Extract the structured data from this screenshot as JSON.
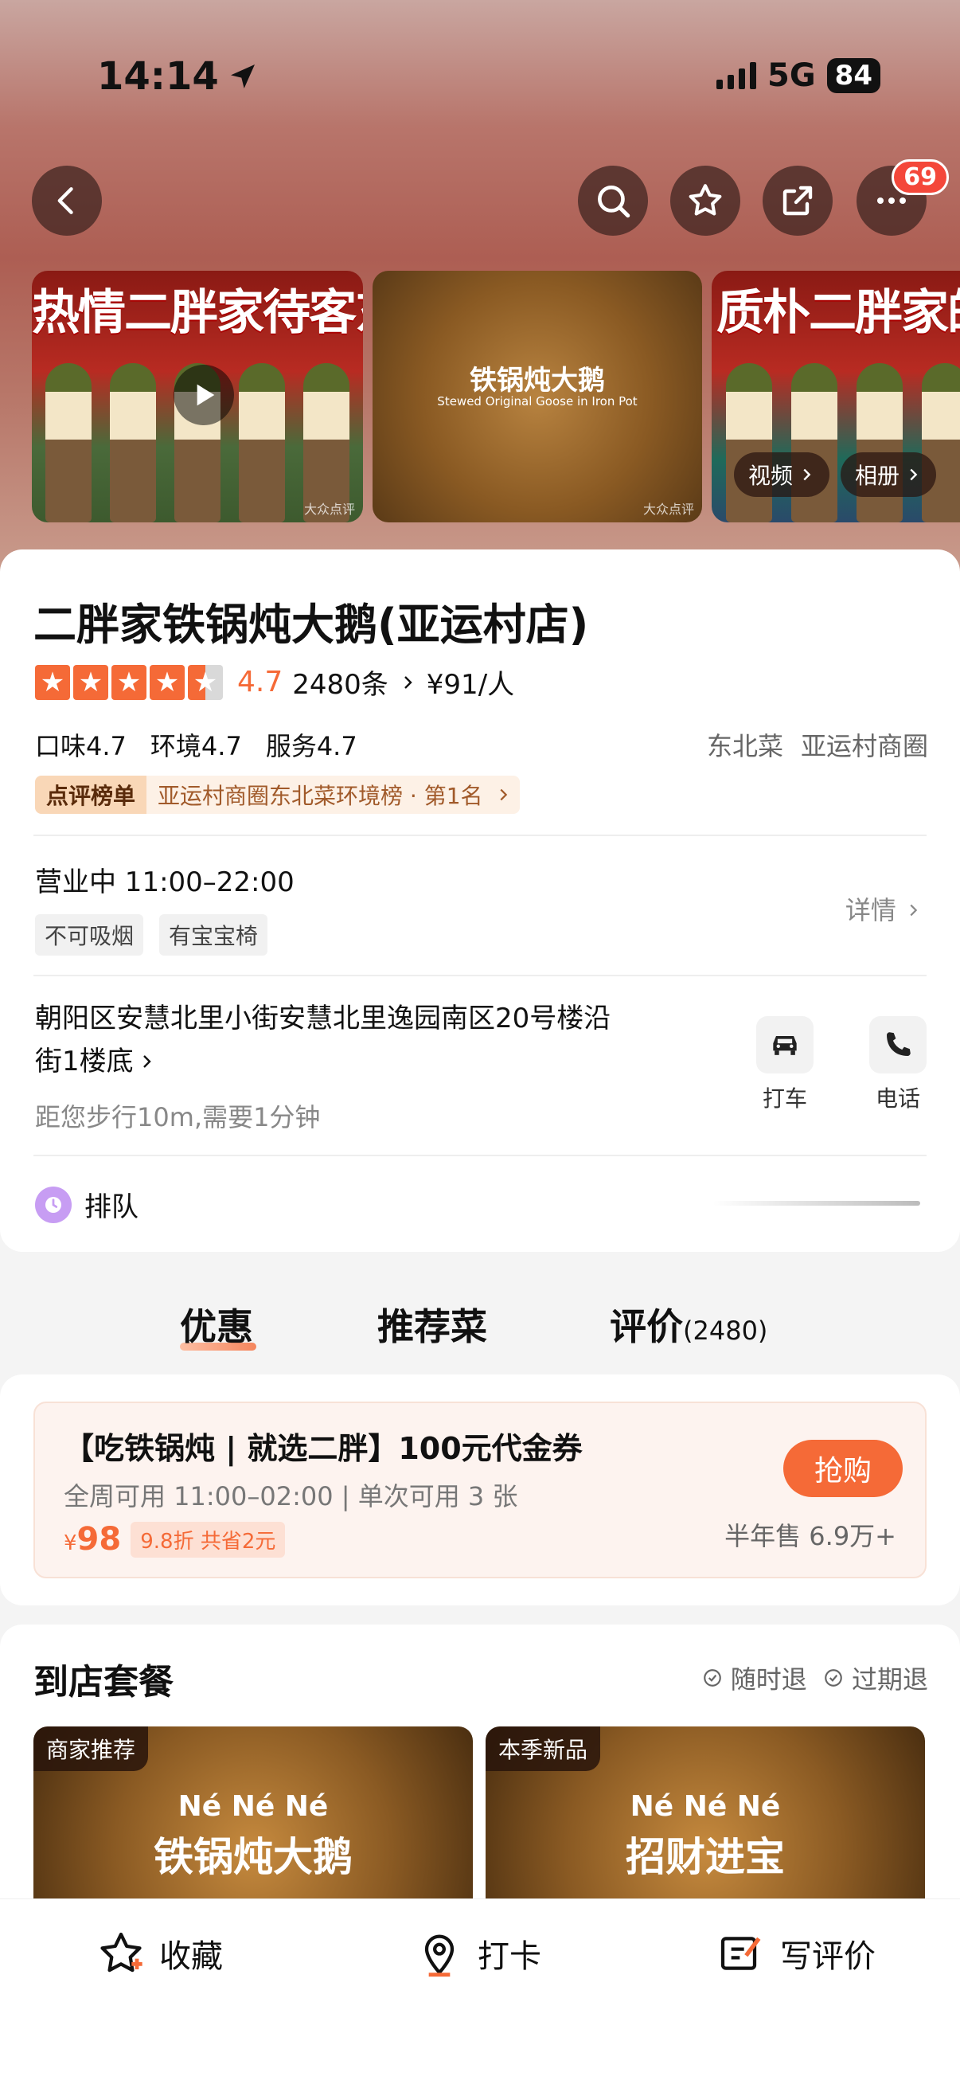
{
  "status": {
    "time": "14:14",
    "network": "5G",
    "battery": "84"
  },
  "topnav": {
    "badge": "69"
  },
  "gallery": {
    "tile1_title": "热情二胖家待客东北人",
    "tile2_title": "铁锅炖大鹅",
    "tile2_sub": "Stewed Original Goose in Iron Pot",
    "tile3_title": "质朴二胖家的鹅大",
    "watermark": "大众点评",
    "video_label": "视频",
    "album_label": "相册"
  },
  "shop": {
    "name": "二胖家铁锅炖大鹅(亚运村店)",
    "rating": "4.7",
    "reviews": "2480条",
    "price": "¥91/人",
    "scores": [
      "口味4.7",
      "环境4.7",
      "服务4.7"
    ],
    "tags": [
      "东北菜",
      "亚运村商圈"
    ],
    "rank_tag": "点评榜单",
    "rank_text": "亚运村商圈东北菜环境榜 · 第1名",
    "hours": "营业中  11:00–22:00",
    "chips": [
      "不可吸烟",
      "有宝宝椅"
    ],
    "detail": "详情",
    "address_line1": "朝阳区安慧北里小街安慧北里逸园南区20号楼沿",
    "address_line2": "街1楼底",
    "distance": "距您步行10m,需要1分钟",
    "taxi": "打车",
    "phone": "电话",
    "queue": "排队"
  },
  "tabs": {
    "deals": "优惠",
    "dishes": "推荐菜",
    "reviews": "评价",
    "reviews_count": "(2480)"
  },
  "deal": {
    "title": "【吃铁锅炖 | 就选二胖】100元代金券",
    "sub": "全周可用 11:00–02:00 | 单次可用 3 张",
    "currency": "¥",
    "price": "98",
    "discount": "9.8折  共省2元",
    "buy": "抢购",
    "sold": "半年售 6.9万+"
  },
  "package": {
    "title": "到店套餐",
    "flag1": "随时退",
    "flag2": "过期退",
    "item1_tag": "商家推荐",
    "item1_line1": "Né Né Né",
    "item1_line2": "铁锅炖大鹅",
    "item2_tag": "本季新品",
    "item2_line1": "Né Né Né",
    "item2_line2": "招财进宝"
  },
  "bottombar": {
    "collect": "收藏",
    "checkin": "打卡",
    "review": "写评价"
  },
  "colors": {
    "accent": "#f56a37"
  }
}
